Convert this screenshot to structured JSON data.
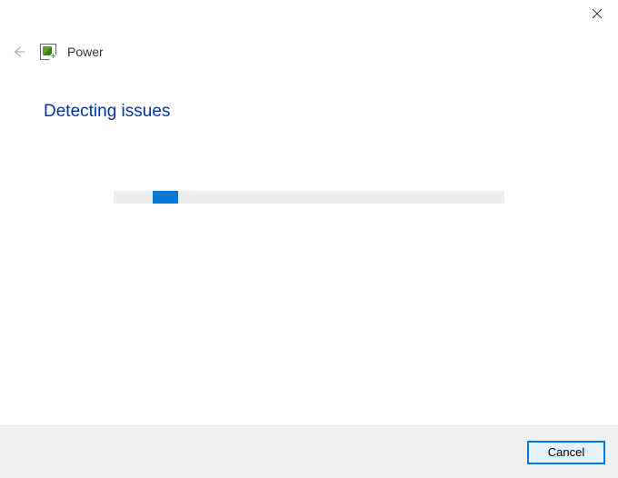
{
  "window": {
    "close_label": "Close"
  },
  "header": {
    "back_label": "Back",
    "troubleshooter_name": "Power",
    "icon_name": "power-troubleshooter-icon"
  },
  "main": {
    "heading": "Detecting issues",
    "progress": {
      "indeterminate": true,
      "chunk_percent": 10
    }
  },
  "footer": {
    "cancel_label": "Cancel"
  }
}
